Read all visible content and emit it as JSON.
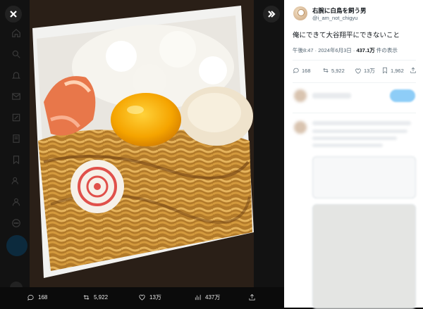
{
  "viewer": {
    "close_icon": "close-icon",
    "expand_icon": "double-chevron-right-icon"
  },
  "action_bar": {
    "replies": "168",
    "reposts": "5,922",
    "likes": "13万",
    "views": "437万"
  },
  "tweet": {
    "display_name": "右腕に白鳥を飼う男",
    "handle": "@i_am_not_chigyu",
    "text": "俺にできて大谷翔平にできないこと",
    "time": "午後8:47 · 2024年6月3日 · ",
    "views_count": "437.1万",
    "views_suffix": " 件の表示",
    "stats": {
      "replies": "168",
      "reposts": "5,922",
      "likes": "13万",
      "bookmarks": "1,962"
    }
  },
  "colors": {
    "accent": "#1d9bf0",
    "panel_bg": "#ffffff",
    "viewer_bg": "#0b0b0b"
  }
}
